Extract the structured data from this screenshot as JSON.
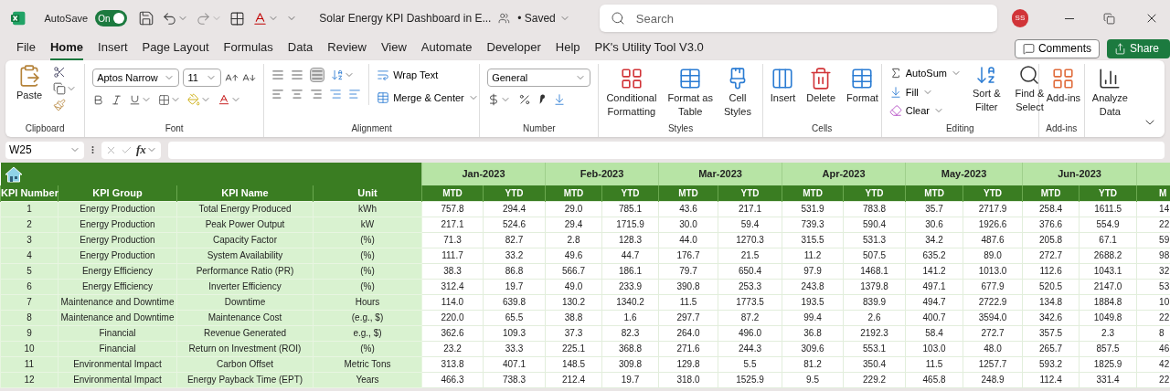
{
  "title_bar": {
    "autosave_label": "AutoSave",
    "autosave_on": true,
    "autosave_state": "On",
    "file_title": "Solar Energy KPI Dashboard in E...",
    "save_status": "• Saved",
    "search_placeholder": "Search",
    "user_initials": "SS"
  },
  "ribbon_tabs": [
    {
      "label": "File",
      "selected": false
    },
    {
      "label": "Home",
      "selected": true
    },
    {
      "label": "Insert",
      "selected": false
    },
    {
      "label": "Page Layout",
      "selected": false
    },
    {
      "label": "Formulas",
      "selected": false
    },
    {
      "label": "Data",
      "selected": false
    },
    {
      "label": "Review",
      "selected": false
    },
    {
      "label": "View",
      "selected": false
    },
    {
      "label": "Automate",
      "selected": false
    },
    {
      "label": "Developer",
      "selected": false
    },
    {
      "label": "Help",
      "selected": false
    },
    {
      "label": "PK's Utility Tool V3.0",
      "selected": false
    }
  ],
  "comments_button": "Comments",
  "share_button": "Share",
  "ribbon": {
    "clipboard": {
      "paste": "Paste",
      "label": "Clipboard"
    },
    "font": {
      "name": "Aptos Narrow",
      "size": "11",
      "label": "Font"
    },
    "alignment": {
      "wrap": "Wrap Text",
      "merge": "Merge & Center",
      "label": "Alignment"
    },
    "number": {
      "format": "General",
      "label": "Number"
    },
    "styles": {
      "buttons": [
        [
          "Conditional",
          "Formatting"
        ],
        [
          "Format as",
          "Table"
        ],
        [
          "Cell",
          "Styles"
        ]
      ],
      "label": "Styles"
    },
    "cells": {
      "buttons": [
        "Insert",
        "Delete",
        "Format"
      ],
      "label": "Cells"
    },
    "editing": {
      "autosum": "AutoSum",
      "fill": "Fill",
      "clear": "Clear",
      "sort": [
        "Sort &",
        "Filter"
      ],
      "find": [
        "Find &",
        "Select"
      ],
      "label": "Editing"
    },
    "addins": {
      "button": "Add-ins",
      "label": "Add-ins"
    },
    "analyze": [
      "Analyze",
      "Data"
    ]
  },
  "formula_bar": {
    "cell": "W25",
    "fx": "fx"
  },
  "sheet": {
    "columns": [
      "KPI Number",
      "KPI Group",
      "KPI Name",
      "Unit"
    ],
    "months": [
      "Jan-2023",
      "Feb-2023",
      "Mar-2023",
      "Apr-2023",
      "May-2023",
      "Jun-2023"
    ],
    "sub_headers": [
      "MTD",
      "YTD",
      "MTD",
      "YTD",
      "MTD",
      "YTD",
      "MTD",
      "YTD",
      "MTD",
      "YTD",
      "MTD",
      "YTD",
      "M"
    ],
    "rows": [
      {
        "number": "1",
        "group": "Energy Production",
        "name": "Total Energy Produced",
        "unit": "kWh",
        "values": [
          "757.8",
          "294.4",
          "29.0",
          "785.1",
          "43.6",
          "217.1",
          "531.9",
          "783.8",
          "35.7",
          "2717.9",
          "258.4",
          "1611.5",
          "14"
        ]
      },
      {
        "number": "2",
        "group": "Energy Production",
        "name": "Peak Power Output",
        "unit": "kW",
        "values": [
          "217.1",
          "524.6",
          "29.4",
          "1715.9",
          "30.0",
          "59.4",
          "739.3",
          "590.4",
          "30.6",
          "1926.6",
          "376.6",
          "554.9",
          "22"
        ]
      },
      {
        "number": "3",
        "group": "Energy Production",
        "name": "Capacity Factor",
        "unit": "(%)",
        "values": [
          "71.3",
          "82.7",
          "2.8",
          "128.3",
          "44.0",
          "1270.3",
          "315.5",
          "531.3",
          "34.2",
          "487.6",
          "205.8",
          "67.1",
          "59"
        ]
      },
      {
        "number": "4",
        "group": "Energy Production",
        "name": "System Availability",
        "unit": "(%)",
        "values": [
          "111.7",
          "33.2",
          "49.6",
          "44.7",
          "176.7",
          "21.5",
          "11.2",
          "507.5",
          "635.2",
          "89.0",
          "272.7",
          "2688.2",
          "98"
        ]
      },
      {
        "number": "5",
        "group": "Energy Efficiency",
        "name": "Performance Ratio (PR)",
        "unit": "(%)",
        "values": [
          "38.3",
          "86.8",
          "566.7",
          "186.1",
          "79.7",
          "650.4",
          "97.9",
          "1468.1",
          "141.2",
          "1013.0",
          "112.6",
          "1043.1",
          "32"
        ]
      },
      {
        "number": "6",
        "group": "Energy Efficiency",
        "name": "Inverter Efficiency",
        "unit": "(%)",
        "values": [
          "312.4",
          "19.7",
          "49.0",
          "233.9",
          "390.8",
          "253.3",
          "243.8",
          "1379.8",
          "497.1",
          "677.9",
          "520.5",
          "2147.0",
          "53"
        ]
      },
      {
        "number": "7",
        "group": "Maintenance and Downtime",
        "name": "Downtime",
        "unit": "Hours",
        "values": [
          "114.0",
          "639.8",
          "130.2",
          "1340.2",
          "11.5",
          "1773.5",
          "193.5",
          "839.9",
          "494.7",
          "2722.9",
          "134.8",
          "1884.8",
          "10"
        ]
      },
      {
        "number": "8",
        "group": "Maintenance and Downtime",
        "name": "Maintenance Cost",
        "unit": "(e.g., $)",
        "values": [
          "220.0",
          "65.5",
          "38.8",
          "1.6",
          "297.7",
          "87.2",
          "99.4",
          "2.6",
          "400.7",
          "3594.0",
          "342.6",
          "1049.8",
          "22"
        ]
      },
      {
        "number": "9",
        "group": "Financial",
        "name": "Revenue Generated",
        "unit": "e.g., $)",
        "values": [
          "362.6",
          "109.3",
          "37.3",
          "82.3",
          "264.0",
          "496.0",
          "36.8",
          "2192.3",
          "58.4",
          "272.7",
          "357.5",
          "2.3",
          "8"
        ]
      },
      {
        "number": "10",
        "group": "Financial",
        "name": "Return on Investment (ROI)",
        "unit": "(%)",
        "values": [
          "23.2",
          "33.3",
          "225.1",
          "368.8",
          "271.6",
          "244.3",
          "309.6",
          "553.1",
          "103.0",
          "48.0",
          "265.7",
          "857.5",
          "46"
        ]
      },
      {
        "number": "11",
        "group": "Environmental Impact",
        "name": "Carbon Offset",
        "unit": "Metric Tons",
        "values": [
          "313.8",
          "407.1",
          "148.5",
          "309.8",
          "129.8",
          "5.5",
          "81.2",
          "350.4",
          "11.5",
          "1257.7",
          "593.2",
          "1825.9",
          "42"
        ]
      },
      {
        "number": "12",
        "group": "Environmental Impact",
        "name": "Energy Payback Time (EPT)",
        "unit": "Years",
        "values": [
          "466.3",
          "738.3",
          "212.4",
          "19.7",
          "318.0",
          "1525.9",
          "9.5",
          "229.2",
          "465.8",
          "248.9",
          "112.4",
          "331.4",
          "22"
        ]
      }
    ]
  }
}
